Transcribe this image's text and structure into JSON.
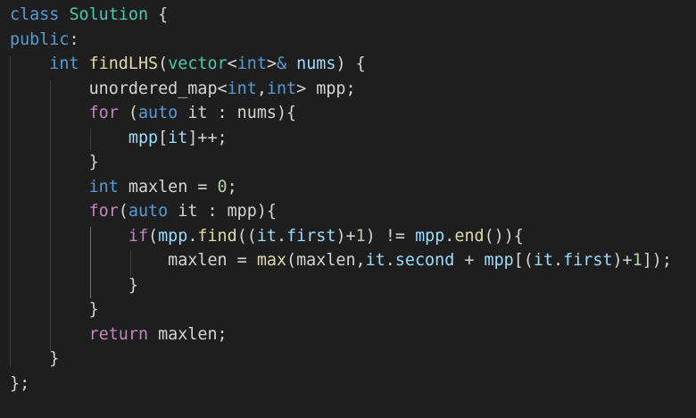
{
  "editor": {
    "theme": {
      "background": "#1e1e1e",
      "default_text": "#d4d4d4",
      "keyword": "#569cd6",
      "control": "#c586c0",
      "type": "#4ec9b0",
      "function": "#dcdcaa",
      "variable": "#9cdcfe",
      "number": "#b5cea8",
      "indent_guide": "#404040"
    },
    "lines": [
      [
        {
          "t": "kw",
          "v": "class"
        },
        {
          "t": "id",
          "v": " "
        },
        {
          "t": "type",
          "v": "Solution"
        },
        {
          "t": "id",
          "v": " {"
        }
      ],
      [
        {
          "t": "kw",
          "v": "public"
        },
        {
          "t": "id",
          "v": ":"
        }
      ],
      [
        {
          "t": "id",
          "v": "    "
        },
        {
          "t": "kw",
          "v": "int"
        },
        {
          "t": "id",
          "v": " "
        },
        {
          "t": "fn",
          "v": "findLHS"
        },
        {
          "t": "id",
          "v": "("
        },
        {
          "t": "type",
          "v": "vector"
        },
        {
          "t": "id",
          "v": "<"
        },
        {
          "t": "kw",
          "v": "int"
        },
        {
          "t": "id",
          "v": ">"
        },
        {
          "t": "kw",
          "v": "&"
        },
        {
          "t": "id",
          "v": " "
        },
        {
          "t": "var",
          "v": "nums"
        },
        {
          "t": "id",
          "v": ") {"
        }
      ],
      [
        {
          "t": "id",
          "v": "        unordered_map<"
        },
        {
          "t": "kw",
          "v": "int"
        },
        {
          "t": "id",
          "v": ","
        },
        {
          "t": "kw",
          "v": "int"
        },
        {
          "t": "id",
          "v": "> mpp;"
        }
      ],
      [
        {
          "t": "id",
          "v": "        "
        },
        {
          "t": "ctl",
          "v": "for"
        },
        {
          "t": "id",
          "v": " ("
        },
        {
          "t": "kw",
          "v": "auto"
        },
        {
          "t": "id",
          "v": " it : nums){"
        }
      ],
      [
        {
          "t": "id",
          "v": "            "
        },
        {
          "t": "var",
          "v": "mpp"
        },
        {
          "t": "id",
          "v": "["
        },
        {
          "t": "var",
          "v": "it"
        },
        {
          "t": "id",
          "v": "]++;"
        }
      ],
      [
        {
          "t": "id",
          "v": "        }"
        }
      ],
      [
        {
          "t": "id",
          "v": "        "
        },
        {
          "t": "kw",
          "v": "int"
        },
        {
          "t": "id",
          "v": " maxlen = "
        },
        {
          "t": "num",
          "v": "0"
        },
        {
          "t": "id",
          "v": ";"
        }
      ],
      [
        {
          "t": "id",
          "v": "        "
        },
        {
          "t": "ctl",
          "v": "for"
        },
        {
          "t": "id",
          "v": "("
        },
        {
          "t": "kw",
          "v": "auto"
        },
        {
          "t": "id",
          "v": " it : mpp){"
        }
      ],
      [
        {
          "t": "id",
          "v": "            "
        },
        {
          "t": "ctl",
          "v": "if"
        },
        {
          "t": "id",
          "v": "("
        },
        {
          "t": "var",
          "v": "mpp"
        },
        {
          "t": "id",
          "v": "."
        },
        {
          "t": "fn",
          "v": "find"
        },
        {
          "t": "id",
          "v": "(("
        },
        {
          "t": "var",
          "v": "it"
        },
        {
          "t": "id",
          "v": "."
        },
        {
          "t": "var",
          "v": "first"
        },
        {
          "t": "id",
          "v": ")+"
        },
        {
          "t": "num",
          "v": "1"
        },
        {
          "t": "id",
          "v": ") != "
        },
        {
          "t": "var",
          "v": "mpp"
        },
        {
          "t": "id",
          "v": "."
        },
        {
          "t": "fn",
          "v": "end"
        },
        {
          "t": "id",
          "v": "()){"
        }
      ],
      [
        {
          "t": "id",
          "v": "                maxlen = "
        },
        {
          "t": "fn",
          "v": "max"
        },
        {
          "t": "id",
          "v": "(maxlen,"
        },
        {
          "t": "var",
          "v": "it"
        },
        {
          "t": "id",
          "v": "."
        },
        {
          "t": "var",
          "v": "second"
        },
        {
          "t": "id",
          "v": " + "
        },
        {
          "t": "var",
          "v": "mpp"
        },
        {
          "t": "id",
          "v": "[("
        },
        {
          "t": "var",
          "v": "it"
        },
        {
          "t": "id",
          "v": "."
        },
        {
          "t": "var",
          "v": "first"
        },
        {
          "t": "id",
          "v": ")+"
        },
        {
          "t": "num",
          "v": "1"
        },
        {
          "t": "id",
          "v": "]);"
        }
      ],
      [
        {
          "t": "id",
          "v": "            }"
        }
      ],
      [
        {
          "t": "id",
          "v": "        }"
        }
      ],
      [
        {
          "t": "id",
          "v": "        "
        },
        {
          "t": "ctl",
          "v": "return"
        },
        {
          "t": "id",
          "v": " maxlen;"
        }
      ],
      [
        {
          "t": "id",
          "v": "    }"
        }
      ],
      [
        {
          "t": "id",
          "v": "};"
        }
      ]
    ]
  }
}
